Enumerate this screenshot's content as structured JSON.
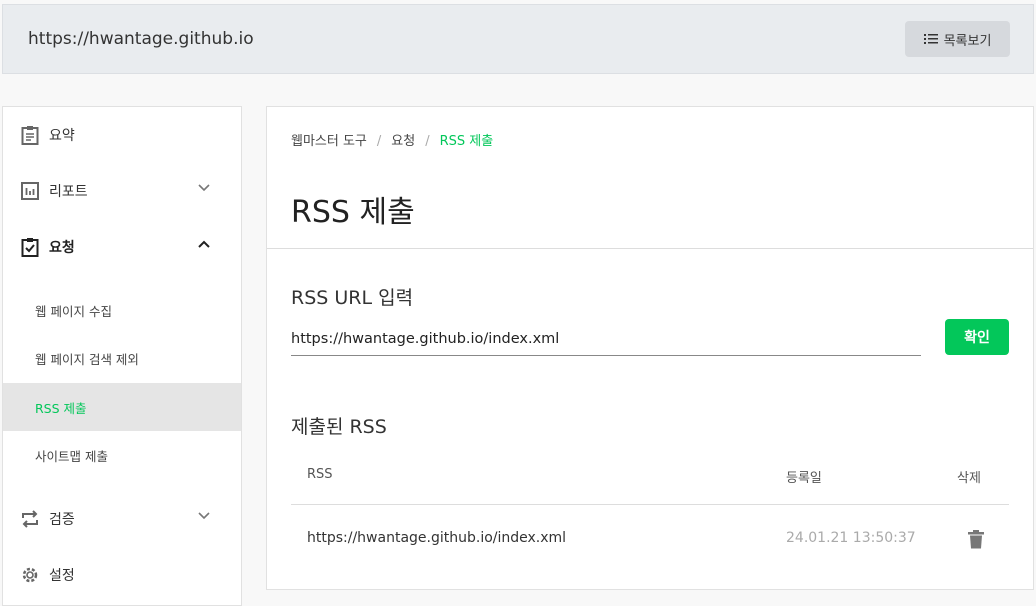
{
  "header": {
    "site_url": "https://hwantage.github.io",
    "list_button": "목록보기"
  },
  "sidebar": {
    "items": [
      {
        "label": "요약",
        "icon": "clipboard-list-icon"
      },
      {
        "label": "리포트",
        "icon": "chart-icon"
      },
      {
        "label": "요청",
        "icon": "clipboard-check-icon"
      },
      {
        "label": "검증",
        "icon": "repeat-icon"
      },
      {
        "label": "설정",
        "icon": "gear-icon"
      }
    ],
    "sub_items": [
      "웹 페이지 수집",
      "웹 페이지 검색 제외",
      "RSS 제출",
      "사이트맵 제출"
    ]
  },
  "main": {
    "breadcrumb": [
      "웹마스터 도구",
      "요청",
      "RSS 제출"
    ],
    "title": "RSS 제출",
    "input_label": "RSS URL 입력",
    "input_value": "https://hwantage.github.io/index.xml",
    "confirm_button": "확인",
    "submitted_heading": "제출된 RSS",
    "table": {
      "headers": [
        "RSS",
        "등록일",
        "삭제"
      ],
      "rows": [
        {
          "rss": "https://hwantage.github.io/index.xml",
          "date": "24.01.21 13:50:37"
        }
      ]
    }
  },
  "colors": {
    "accent": "#03c75a"
  }
}
